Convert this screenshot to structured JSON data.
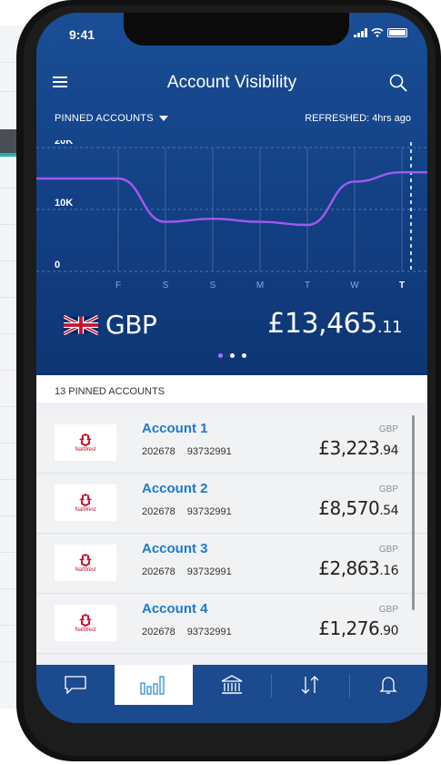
{
  "status_bar": {
    "time": "9:41"
  },
  "header": {
    "title": "Account Visibility"
  },
  "filters": {
    "pinned_label": "PINNED ACCOUNTS",
    "refreshed": "REFRESHED: 4hrs ago"
  },
  "chart_data": {
    "type": "line",
    "x": [
      "F",
      "S",
      "S",
      "M",
      "T",
      "W",
      "T"
    ],
    "ylabels": [
      "20K",
      "10K",
      "0"
    ],
    "ylim": [
      0,
      20000
    ],
    "series": [
      {
        "values": [
          15000,
          8000,
          8500,
          8000,
          7500,
          14500,
          16000
        ]
      }
    ],
    "highlight_x": "T",
    "line_color": "#a259f0",
    "grid": true
  },
  "currency": {
    "code": "GBP",
    "total_main": "£13,465",
    "total_dec": ".11"
  },
  "pinned": {
    "header": "13 PINNED ACCOUNTS"
  },
  "accounts": [
    {
      "name": "Account 1",
      "sort_code": "202678",
      "number": "93732991",
      "currency": "GBP",
      "balance_main": "£3,223",
      "balance_dec": ".94",
      "bank": "NatWest"
    },
    {
      "name": "Account 2",
      "sort_code": "202678",
      "number": "93732991",
      "currency": "GBP",
      "balance_main": "£8,570",
      "balance_dec": ".54",
      "bank": "NatWest"
    },
    {
      "name": "Account 3",
      "sort_code": "202678",
      "number": "93732991",
      "currency": "GBP",
      "balance_main": "£2,863",
      "balance_dec": ".16",
      "bank": "NatWest"
    },
    {
      "name": "Account 4",
      "sort_code": "202678",
      "number": "93732991",
      "currency": "GBP",
      "balance_main": "£1,276",
      "balance_dec": ".90",
      "bank": "NatWest"
    }
  ],
  "tabs": [
    {
      "icon": "chat-icon"
    },
    {
      "icon": "bar-chart-icon",
      "active": true
    },
    {
      "icon": "bank-icon"
    },
    {
      "icon": "transfer-icon"
    },
    {
      "icon": "bell-icon"
    }
  ],
  "colors": {
    "primary": "#123e82",
    "accent": "#a259f0",
    "link": "#1b7ad1",
    "brand_red": "#c8102e"
  }
}
